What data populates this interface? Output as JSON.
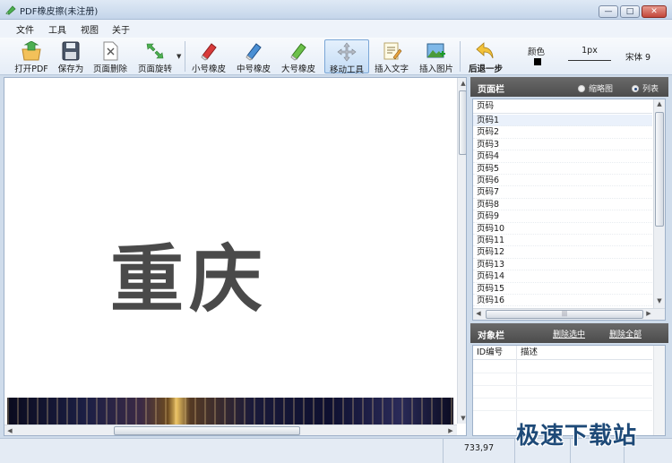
{
  "window": {
    "title": "PDF橡皮擦(未注册)",
    "min_glyph": "—",
    "max_glyph": "□",
    "close_glyph": "✕"
  },
  "menu": [
    "文件",
    "工具",
    "视图",
    "关于"
  ],
  "toolbar": {
    "open_pdf": "打开PDF",
    "save_as": "保存为",
    "delete_page": "页面删除",
    "rotate_page": "页面旋转",
    "small_eraser": "小号橡皮",
    "medium_eraser": "中号橡皮",
    "large_eraser": "大号橡皮",
    "move_tool": "移动工具",
    "insert_text": "插入文字",
    "insert_image": "插入图片",
    "undo": "后退一步",
    "color_label": "颜色",
    "color_value": "#000000",
    "line_size": "1px",
    "font": "宋体 9"
  },
  "canvas": {
    "text": "重庆"
  },
  "page_panel": {
    "title": "页面栏",
    "option_thumbnail": "缩略图",
    "option_list": "列表",
    "selected_option": "列表",
    "column_header": "页码",
    "pages": [
      "页码1",
      "页码2",
      "页码3",
      "页码4",
      "页码5",
      "页码6",
      "页码7",
      "页码8",
      "页码9",
      "页码10",
      "页码11",
      "页码12",
      "页码13",
      "页码14",
      "页码15",
      "页码16"
    ]
  },
  "object_panel": {
    "title": "对象栏",
    "delete_selected": "删除选中",
    "delete_all": "删除全部",
    "col_id": "ID编号",
    "col_desc": "描述"
  },
  "status": {
    "coords": "733,97"
  },
  "watermark": "极速下载站"
}
